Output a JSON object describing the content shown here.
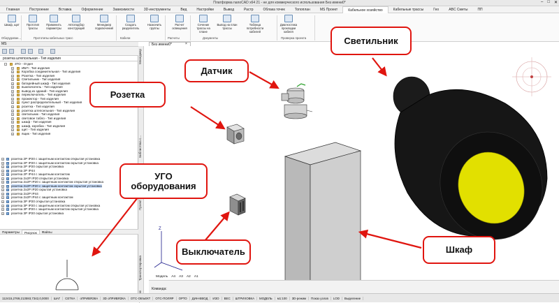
{
  "app": {
    "title": "Платформа nanoCAD x64 21 - не для коммерческого использования Без имени0*"
  },
  "menu": [
    "Главная",
    "Построение",
    "Вставка",
    "Оформление",
    "Зависимости",
    "3D-инструменты",
    "Вид",
    "Настройки",
    "Вывод",
    "Растр",
    "Облака точек",
    "Топоплан",
    "MS Проект",
    "Кабельное хозяйство",
    "Кабельные трассы",
    "Гео",
    "ABC Сметы",
    "ПП"
  ],
  "menu_active_index": 13,
  "ribbon": {
    "buttons": [
      "Шкаф, щит",
      "Прототип трассы",
      "Применить параметры",
      "Автоподбор конструкций",
      "Менеджер подключений",
      "Создать разделитель",
      "Назначить группы",
      "Расчет освещения",
      "Сечение трассы на плане",
      "Вывод на план трассы",
      "Таблица потребности кабелей",
      "Диагностика прокладки кабеля"
    ],
    "groups": [
      "Оборудован...",
      "Прототипы кабельных трасс",
      "Кабели",
      "Расчеты",
      "Документы",
      "Проверка проекта"
    ]
  },
  "left_panel": {
    "header": "MS",
    "combo": "розетка штепсельная - Тип изделия",
    "tree1": [
      {
        "t": "3ТО - Отдел",
        "lvl": 1,
        "box": "-"
      },
      {
        "t": "ИБП - Тип изделия",
        "lvl": 2,
        "box": "+"
      },
      {
        "t": "Коробка соединительная - Тип изделия",
        "lvl": 2,
        "box": "+"
      },
      {
        "t": "Розетка - Тип изделия",
        "lvl": 2,
        "box": "+"
      },
      {
        "t": "Светильник - Тип изделия",
        "lvl": 2,
        "box": "+"
      },
      {
        "t": "батарейный шкаф - Тип изделия",
        "lvl": 2,
        "box": "+"
      },
      {
        "t": "выключатель - Тип изделия",
        "lvl": 2,
        "box": "+"
      },
      {
        "t": "вывод из зданий - Тип изделия",
        "lvl": 2,
        "box": "+"
      },
      {
        "t": "переключатель - Тип изделия",
        "lvl": 2,
        "box": "+"
      },
      {
        "t": "прожектор - Тип изделия",
        "lvl": 2,
        "box": "+"
      },
      {
        "t": "пункт распределительный - Тип изделия",
        "lvl": 2,
        "box": "+"
      },
      {
        "t": "розетка - Тип изделия",
        "lvl": 2,
        "box": "+"
      },
      {
        "t": "розетка штепсельная - Тип изделия",
        "lvl": 2,
        "box": "+"
      },
      {
        "t": "светильник - Тип изделия",
        "lvl": 2,
        "box": "+"
      },
      {
        "t": "световое табло - Тип изделия",
        "lvl": 2,
        "box": "+"
      },
      {
        "t": "шкаф - Тип изделия",
        "lvl": 2,
        "box": "+"
      },
      {
        "t": "шкаф, коробка - Тип изделия",
        "lvl": 2,
        "box": "+"
      },
      {
        "t": "щит - Тип изделия",
        "lvl": 2,
        "box": "+"
      },
      {
        "t": "ящик - Тип изделия",
        "lvl": 2,
        "box": "+"
      }
    ],
    "tree2": [
      "розетка 2Р IP20 с защитным контактом открытая установка",
      "розетка 2Р IP20 с защитным контактом скрытая установка",
      "розетка 2Р IP20 скрытая установка",
      "розетка 2Р IP44",
      "розетка 2Р IP44 с защитным контактом",
      "розетка 2х2Р IP20 открытая установка",
      "розетка 2х2Р IP20 с защитным контактом открытая установка",
      "розетка 2х2Р IP20 с защитным контактом скрытая установка",
      "розетка 2х2Р IP20 скрытая установка",
      "розетка 2х2Р IP44",
      "розетка 2х2Р IP44 с защитным контактом",
      "розетка 3Р IP20 открытая установка",
      "розетка 3Р IP20 с защитным контактом открытая установка",
      "розетка 3Р IP20 с защитным контактом скрытая установка",
      "розетка 3Р IP20 скрытая установка"
    ],
    "tree2_selected_index": 7,
    "tabs": [
      "Параметры",
      "Рисунок",
      "Файлы"
    ],
    "tabs_active_index": 1
  },
  "vertical_tabs": [
    "Менеджер",
    "Свойства",
    "Библиотека с...",
    "Проект",
    "Транспортировка",
    "Текущие пер"
  ],
  "document": {
    "tab": "Без имени0*"
  },
  "layouts": [
    "Модель",
    "А4",
    "А3",
    "А2",
    "А1"
  ],
  "command": {
    "prompt": "Команда:"
  },
  "statusbar": [
    "112415,2769,213593,7342,0,0000",
    "ШАГ",
    "СЕТКА",
    "оПРИВЯЗКА",
    "3D оПРИВЯЗКА",
    "ОТС-ОБЪЕКТ",
    "ОТС-ПОЛЯР",
    "ОРТО",
    "ДИН-ВВОД",
    "ИЗО",
    "ВЕС",
    "ШТРИХОВКА",
    "МОДЕЛЬ",
    "м1:100",
    "3D-режим",
    "Показ узлов",
    "LOD",
    "Выделение"
  ],
  "callouts": {
    "svetilnik": "Светильник",
    "datchik": "Датчик",
    "rozetka": "Розетка",
    "ugo": "УГО оборудования",
    "vyklyuchatel": "Выключатель",
    "shkaf": "Шкаф"
  },
  "colors": {
    "callout_border": "#e0150f",
    "lamp_body": "#141414",
    "lamp_lens": "#e2e000",
    "selection": "#c9defc"
  }
}
